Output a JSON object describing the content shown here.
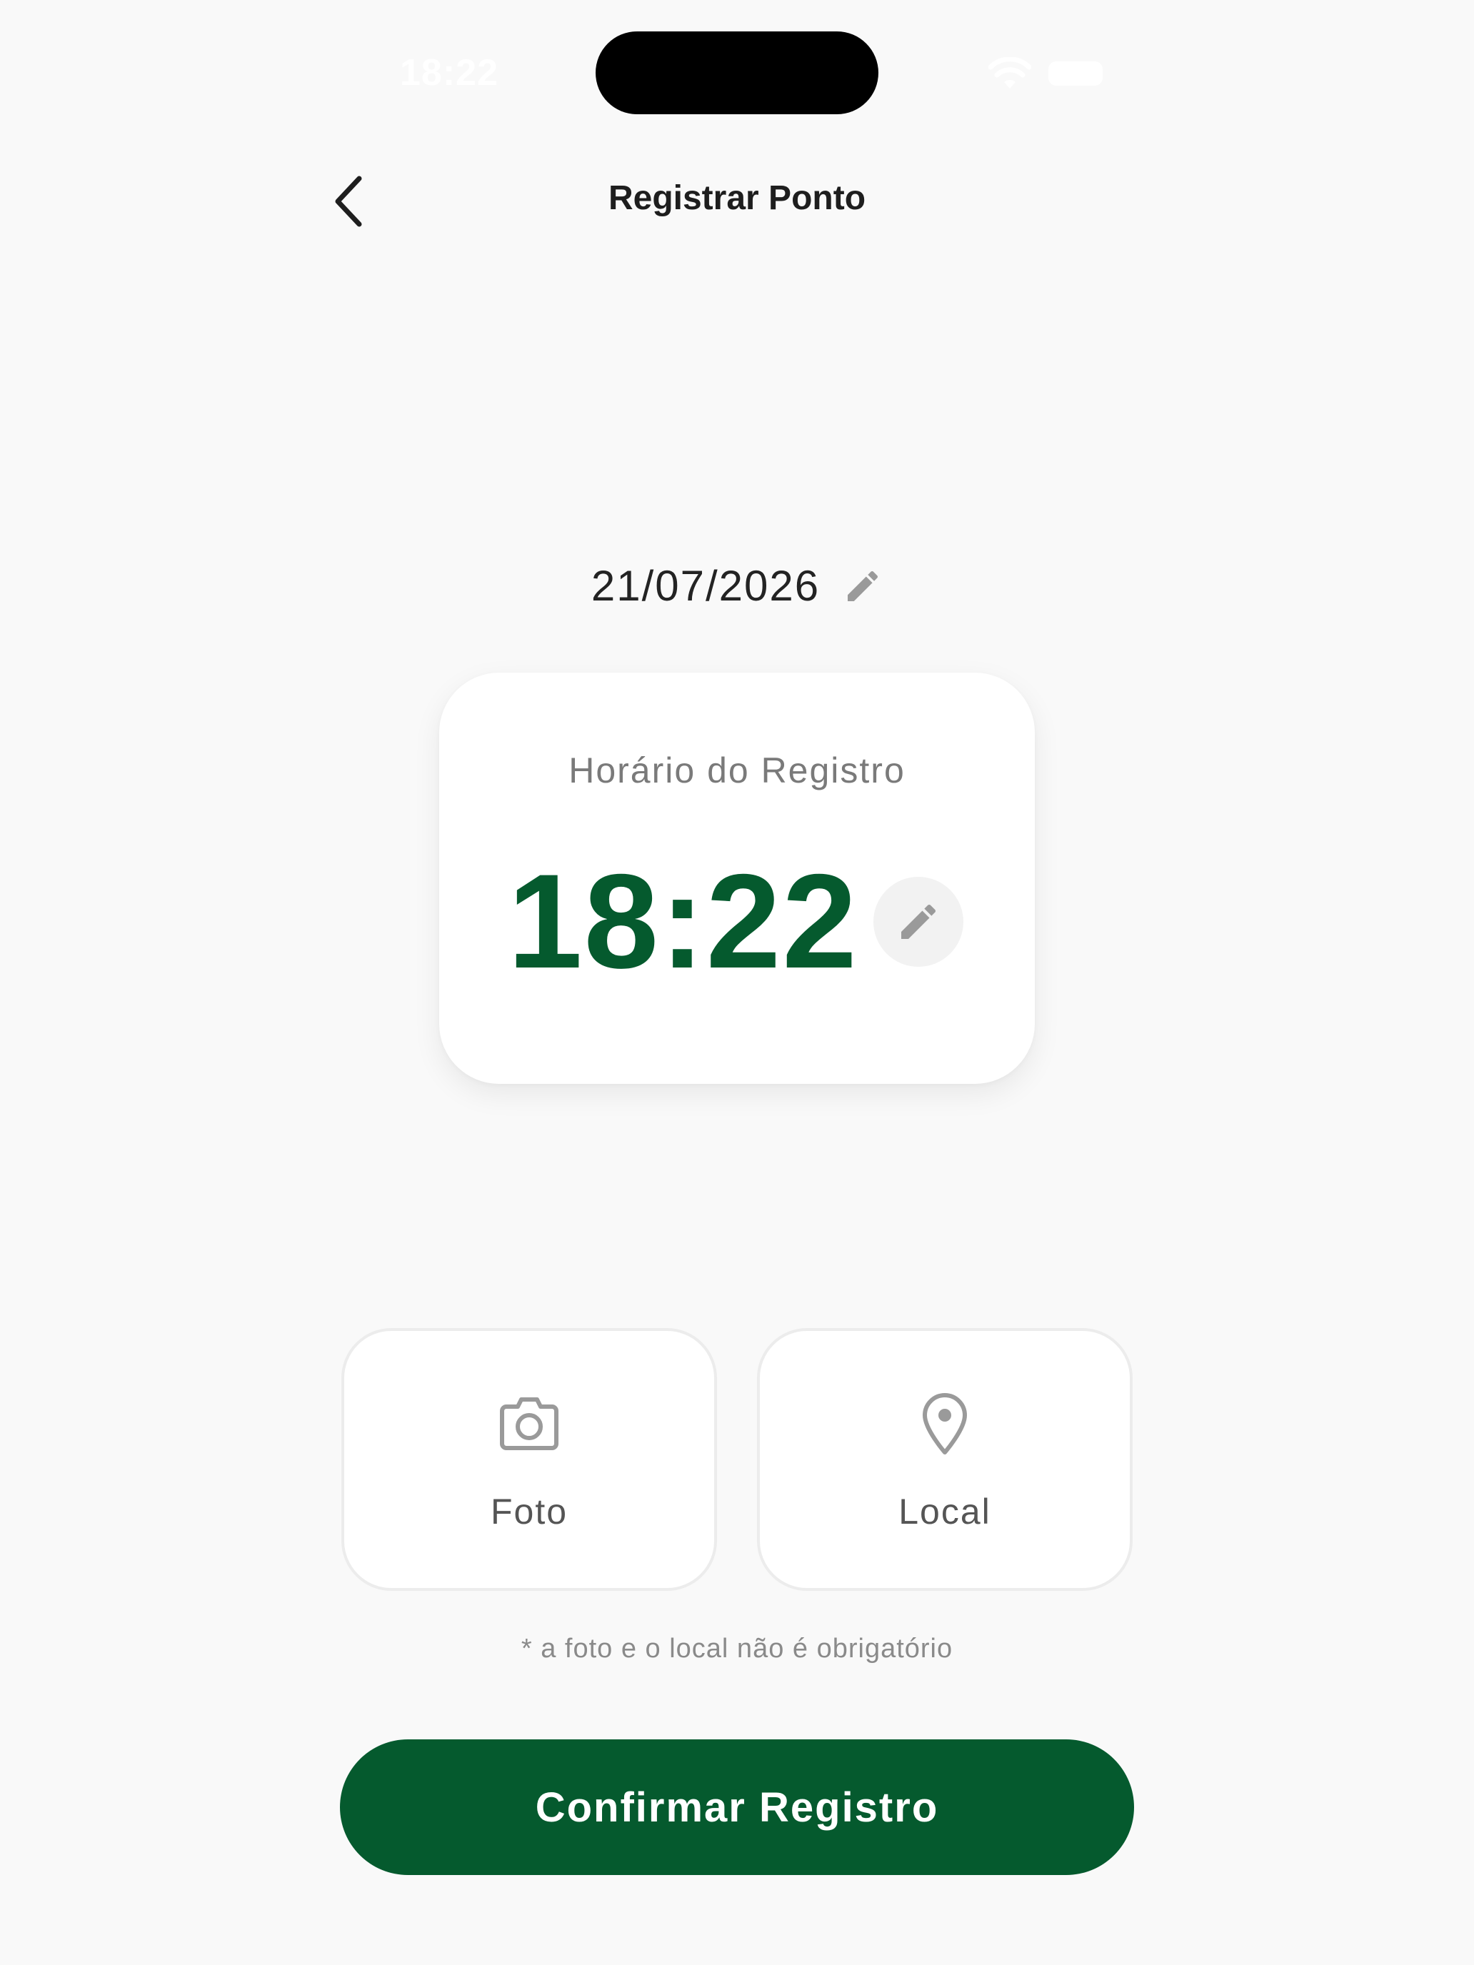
{
  "status_bar": {
    "time": "18:22",
    "icons": [
      "wifi-icon",
      "battery-icon"
    ]
  },
  "header": {
    "title": "Registrar Ponto",
    "back_icon": "chevron-left-icon"
  },
  "date": {
    "value": "21/07/2026",
    "edit_icon": "pencil-icon"
  },
  "time_card": {
    "label": "Horário do Registro",
    "time": "18:22",
    "edit_icon": "pencil-icon"
  },
  "options": [
    {
      "label": "Foto",
      "icon": "camera-icon"
    },
    {
      "label": "Local",
      "icon": "map-pin-icon"
    }
  ],
  "hint": "* a foto e o local não é obrigatório",
  "confirm_button": "Confirmar Registro",
  "colors": {
    "primary": "#055a2e",
    "background": "#f9f9f9",
    "card": "#ffffff",
    "icon_gray": "#9a9a9a"
  }
}
